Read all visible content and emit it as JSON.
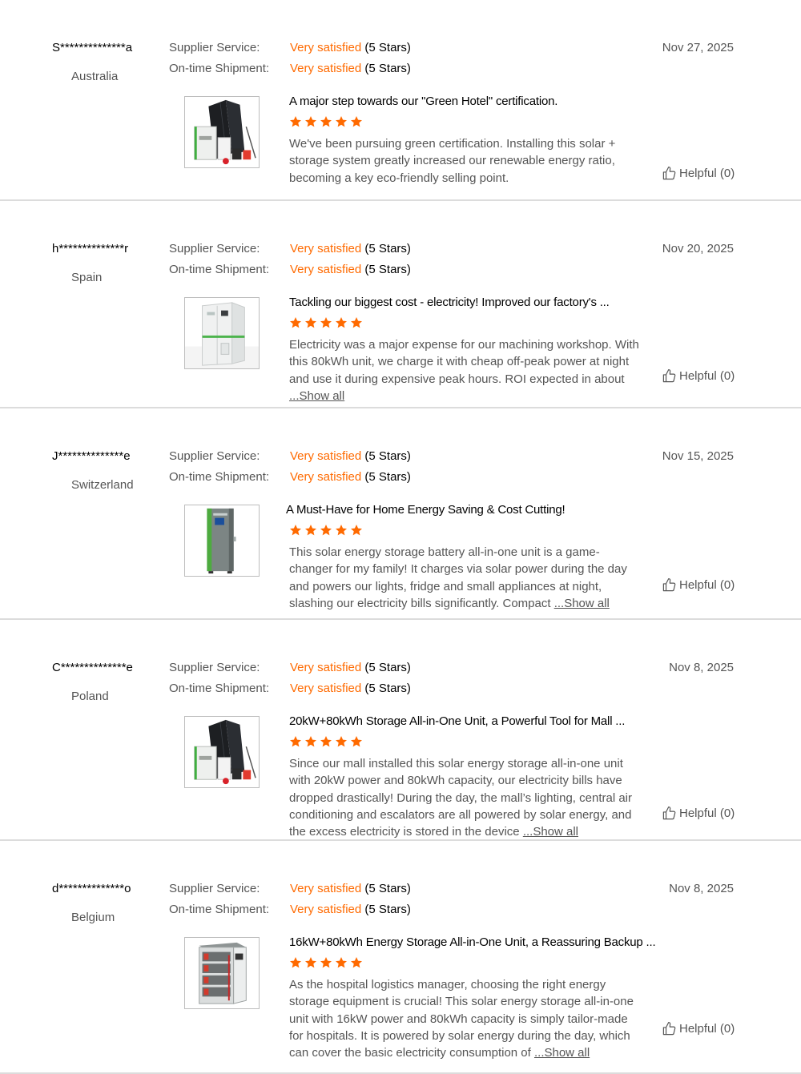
{
  "labels": {
    "supplier_service": "Supplier Service:",
    "ontime_shipment": "On-time Shipment:",
    "show_all": "...Show all"
  },
  "colors": {
    "satisfied": "#ff6a00",
    "star": "#ff6a00",
    "divider": "#dcdcdc"
  },
  "reviews": [
    {
      "user": "S**************a",
      "country": "Australia",
      "date": "Nov 27, 2025",
      "supplier_service": {
        "text": "Very satisfied",
        "stars_text": "(5 Stars)"
      },
      "ontime_shipment": {
        "text": "Very satisfied",
        "stars_text": "(5 Stars)"
      },
      "image_icon": "solar-panel-kit-icon",
      "title": "A major step towards our \"Green Hotel\" certification.",
      "rating": 5,
      "content": "We've been pursuing green certification. Installing this solar + storage system greatly increased our renewable energy ratio, becoming a key eco-friendly selling point.",
      "show_all": false,
      "helpful": "Helpful (0)"
    },
    {
      "user": "h**************r",
      "country": "Spain",
      "date": "Nov 20, 2025",
      "supplier_service": {
        "text": "Very satisfied",
        "stars_text": "(5 Stars)"
      },
      "ontime_shipment": {
        "text": "Very satisfied",
        "stars_text": "(5 Stars)"
      },
      "image_icon": "storage-cabinet-icon",
      "title": "Tackling our biggest cost - electricity! Improved our factory's ...",
      "rating": 5,
      "content": "Electricity was a major expense for our machining workshop. With this 80kWh unit, we charge it with cheap off-peak power at night and use it during expensive peak hours. ROI expected in about",
      "show_all": true,
      "helpful": "Helpful (0)"
    },
    {
      "user": "J**************e",
      "country": "Switzerland",
      "date": "Nov 15, 2025",
      "supplier_service": {
        "text": "Very satisfied",
        "stars_text": "(5 Stars)"
      },
      "ontime_shipment": {
        "text": "Very satisfied",
        "stars_text": "(5 Stars)"
      },
      "image_icon": "battery-tower-icon",
      "title": "A Must-Have for Home Energy Saving & Cost Cutting!",
      "rating": 5,
      "content": "This solar energy storage battery all-in-one unit is a game-changer for my family! It charges via solar power during the day and powers our lights, fridge and small appliances at night, slashing our electricity bills significantly. Compact",
      "show_all": true,
      "helpful": "Helpful (0)"
    },
    {
      "user": "C**************e",
      "country": "Poland",
      "date": "Nov 8, 2025",
      "supplier_service": {
        "text": "Very satisfied",
        "stars_text": "(5 Stars)"
      },
      "ontime_shipment": {
        "text": "Very satisfied",
        "stars_text": "(5 Stars)"
      },
      "image_icon": "solar-panel-kit-icon",
      "title": "20kW+80kWh Storage All-in-One Unit, a Powerful Tool for Mall ...",
      "rating": 5,
      "content": "Since our mall installed this solar energy storage all-in-one unit with 20kW power and 80kWh capacity, our electricity bills have dropped drastically! During the day, the mall’s lighting, central air conditioning and escalators are all powered by solar energy, and the excess electricity is stored in the device",
      "show_all": true,
      "helpful": "Helpful (0)"
    },
    {
      "user": "d**************o",
      "country": "Belgium",
      "date": "Nov 8, 2025",
      "supplier_service": {
        "text": "Very satisfied",
        "stars_text": "(5 Stars)"
      },
      "ontime_shipment": {
        "text": "Very satisfied",
        "stars_text": "(5 Stars)"
      },
      "image_icon": "battery-rack-icon",
      "title": "16kW+80kWh Energy Storage All-in-One Unit, a Reassuring Backup ...",
      "rating": 5,
      "content": "As the hospital logistics manager, choosing the right energy storage equipment is crucial! This solar energy storage all-in-one unit with 16kW power and 80kWh capacity is simply tailor-made for hospitals. It is powered by solar energy during the day, which can cover the basic electricity consumption of",
      "show_all": true,
      "helpful": "Helpful (0)"
    }
  ]
}
